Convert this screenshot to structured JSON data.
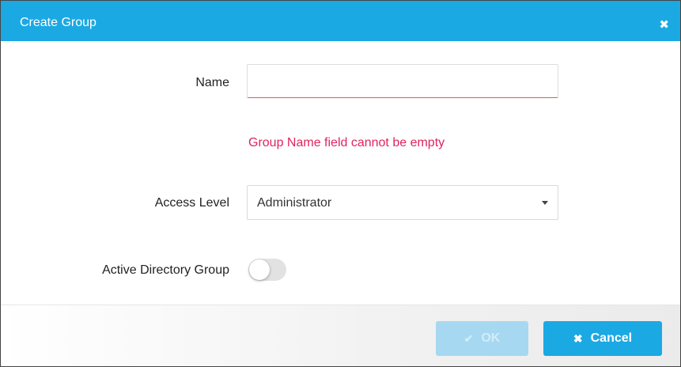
{
  "dialog": {
    "title": "Create Group",
    "close_icon": "close-icon"
  },
  "form": {
    "name_label": "Name",
    "name_value": "",
    "name_placeholder": "",
    "error_message": "Group Name field cannot be empty",
    "access_level_label": "Access Level",
    "access_level_value": "Administrator",
    "ad_group_label": "Active Directory Group",
    "ad_group_enabled": false
  },
  "footer": {
    "ok_label": "OK",
    "ok_icon": "check-icon",
    "ok_enabled": false,
    "cancel_label": "Cancel",
    "cancel_icon": "x-icon"
  },
  "colors": {
    "accent": "#1ba9e4",
    "error": "#e0245e",
    "disabled_button": "#a7d8f1"
  }
}
